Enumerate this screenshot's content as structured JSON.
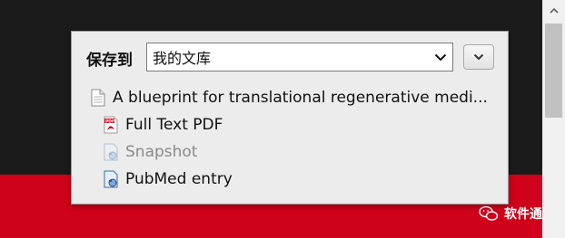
{
  "save_to_label": "保存到",
  "collection": {
    "selected": "我的文库"
  },
  "item": {
    "title": "A blueprint for translational regenerative medi...",
    "attachments": [
      {
        "label": "Full Text PDF",
        "icon": "pdf-icon",
        "disabled": false
      },
      {
        "label": "Snapshot",
        "icon": "snapshot-icon",
        "disabled": true
      },
      {
        "label": "PubMed entry",
        "icon": "snapshot-icon",
        "disabled": false
      }
    ]
  },
  "watermark": {
    "text": "软件通"
  },
  "colors": {
    "background_red": "#d0021b",
    "background_dark": "#1b1b1b",
    "popup_bg": "#ececec"
  }
}
